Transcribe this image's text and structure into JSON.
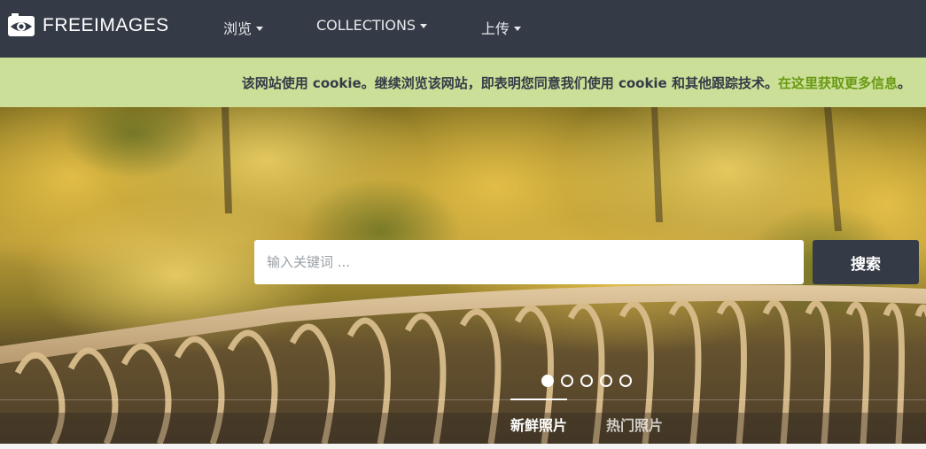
{
  "brand": {
    "name": "FREEIMAGES"
  },
  "nav": {
    "items": [
      {
        "label": "浏览"
      },
      {
        "label": "COLLECTIONS"
      },
      {
        "label": "上传"
      }
    ]
  },
  "cookie": {
    "message": "该网站使用 cookie。继续浏览该网站，即表明您同意我们使用 cookie 和其他跟踪技术。",
    "link": "在这里获取更多信息",
    "suffix": "。"
  },
  "search": {
    "placeholder": "输入关键词 ...",
    "value": "",
    "button": "搜索"
  },
  "carousel": {
    "slides": 5,
    "active": 0
  },
  "tabs": [
    {
      "label": "新鲜照片",
      "active": true
    },
    {
      "label": "热门照片",
      "active": false
    }
  ],
  "colors": {
    "navbar": "#353b46",
    "cookie_bar": "#cbdf98",
    "cookie_link": "#6a9a14",
    "search_button": "#353b46"
  },
  "icons": {
    "logo": "camera-eye-icon",
    "dropdown": "caret-down-icon"
  }
}
